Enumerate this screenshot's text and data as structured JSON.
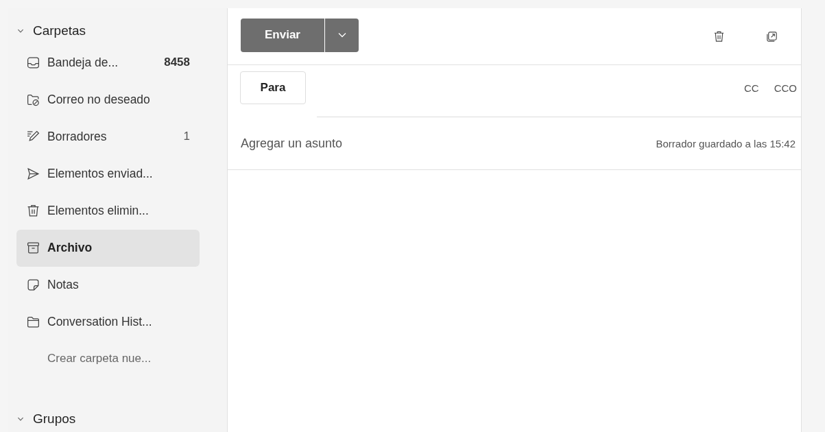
{
  "sidebar": {
    "header": {
      "label": "Carpetas",
      "expanded": true
    },
    "items": [
      {
        "label": "Bandeja de...",
        "count": "8458",
        "unread": true,
        "selected": false
      },
      {
        "label": "Correo no deseado",
        "selected": false
      },
      {
        "label": "Borradores",
        "count": "1",
        "unread": false,
        "selected": false
      },
      {
        "label": "Elementos enviad...",
        "selected": false
      },
      {
        "label": "Elementos elimin...",
        "selected": false
      },
      {
        "label": "Archivo",
        "selected": true
      },
      {
        "label": "Notas",
        "selected": false
      },
      {
        "label": "Conversation Hist...",
        "selected": false
      }
    ],
    "new_folder_link": "Crear carpeta nue...",
    "groups_header": {
      "label": "Grupos",
      "expanded": true
    }
  },
  "compose": {
    "send_button": "Enviar",
    "to_button": "Para",
    "cc": "CC",
    "bcc": "CCO",
    "subject": {
      "placeholder": "Agregar un asunto"
    },
    "draft_status": "Borrador guardado a las 15:42"
  }
}
